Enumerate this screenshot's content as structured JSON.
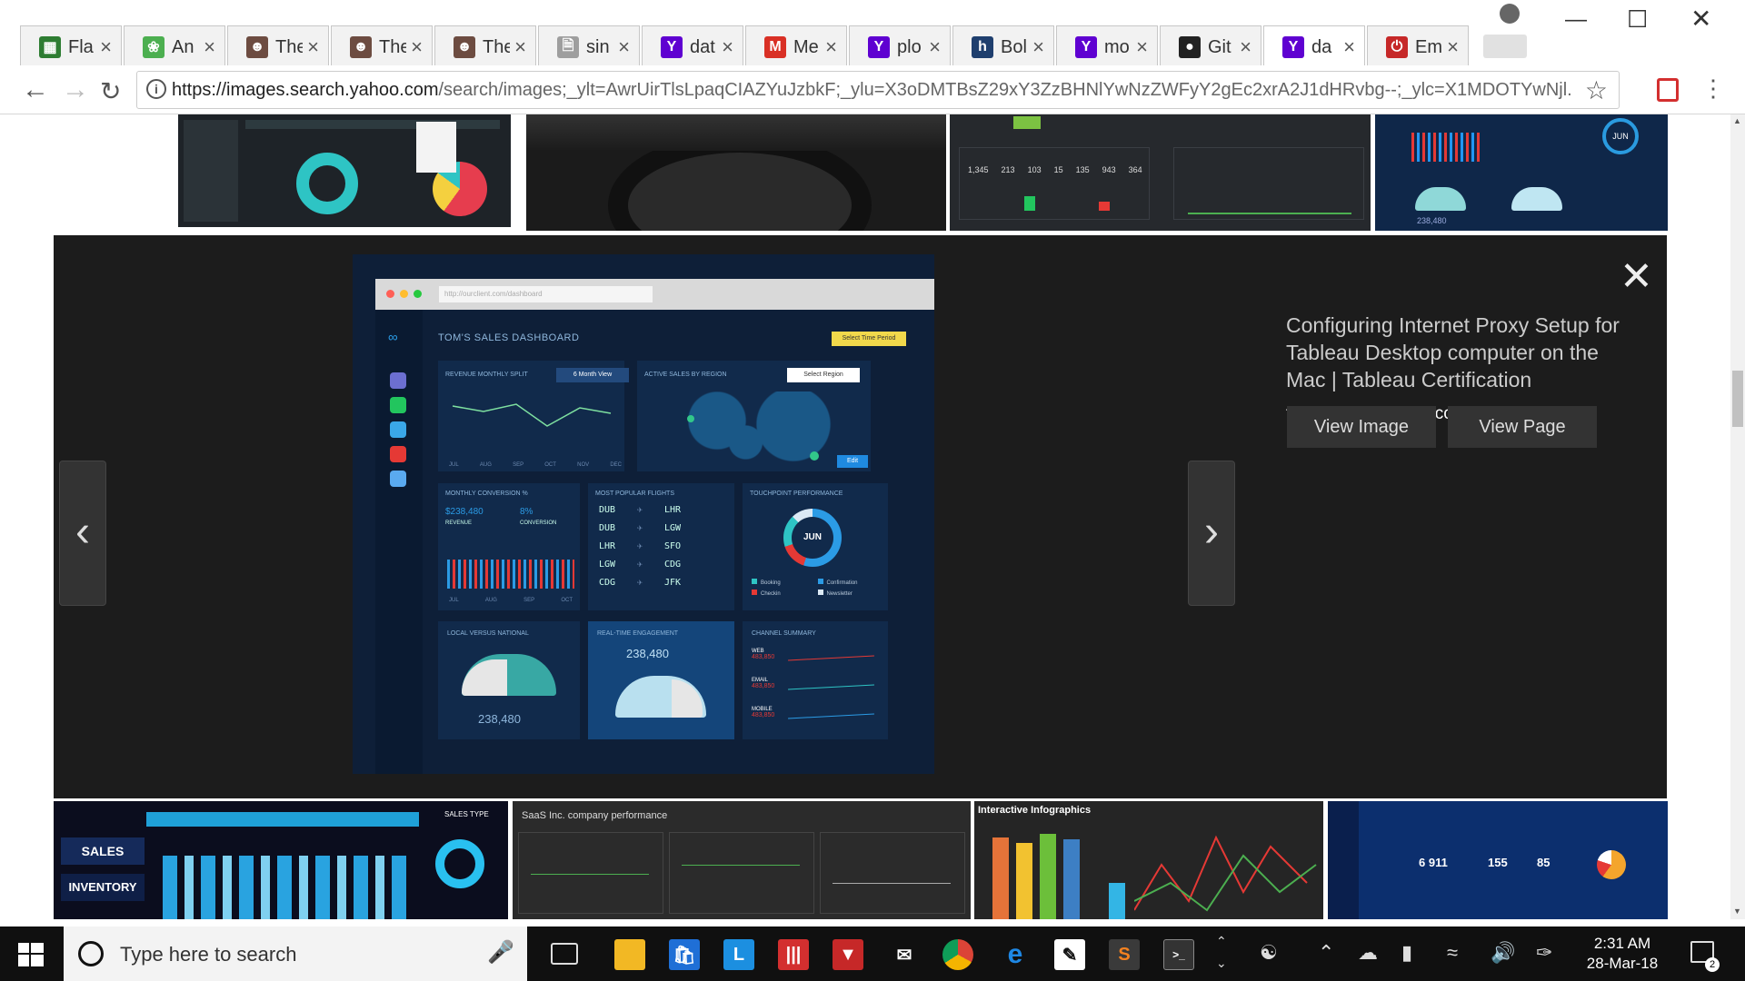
{
  "browser": {
    "tabs": [
      {
        "title": "Fla",
        "icon": "grid-icon",
        "color": "#2e7d32"
      },
      {
        "title": "An",
        "icon": "leaf-icon",
        "color": "#4caf50"
      },
      {
        "title": "The",
        "icon": "person-icon",
        "color": "#6d4c41"
      },
      {
        "title": "The",
        "icon": "person-icon",
        "color": "#6d4c41"
      },
      {
        "title": "The",
        "icon": "person-icon",
        "color": "#6d4c41"
      },
      {
        "title": "sin",
        "icon": "document-icon",
        "color": "#9e9e9e"
      },
      {
        "title": "dat",
        "icon": "yahoo-icon",
        "color": "#5f01d1"
      },
      {
        "title": "Me",
        "icon": "gmail-icon",
        "color": "#d93025"
      },
      {
        "title": "plo",
        "icon": "yahoo-icon",
        "color": "#5f01d1"
      },
      {
        "title": "Bol",
        "icon": "h-icon",
        "color": "#1f3f6e"
      },
      {
        "title": "mo",
        "icon": "yahoo-icon",
        "color": "#5f01d1"
      },
      {
        "title": "Git",
        "icon": "github-icon",
        "color": "#222222"
      },
      {
        "title": "da",
        "icon": "yahoo-icon",
        "color": "#5f01d1",
        "active": true
      },
      {
        "title": "Em",
        "icon": "power-icon",
        "color": "#c62828"
      }
    ],
    "url_domain": "https://images.search.yahoo.com",
    "url_path": "/search/images;_ylt=AwrUirTlsLpaqCIAZYuJzbkF;_ylu=X3oDMTBsZ29xY3ZzBHNlYwNzZWFyY2gEc2xrA2J1dHRvbg--;_ylc=X1MDOTYwNjl..."
  },
  "viewer": {
    "title": "Configuring Internet Proxy Setup for Tableau Desktop computer on the Mac | Tableau Certification",
    "source": "tableaucertification.com",
    "dimensions": "736x659",
    "view_image": "View Image",
    "view_page": "View Page"
  },
  "preview": {
    "url": "http://ourclient.com/dashboard",
    "title": "TOM'S SALES DASHBOARD",
    "select_period": "Select Time Period",
    "revenue_split": "REVENUE MONTHLY SPLIT",
    "month_view": "6 Month View",
    "months": [
      "JUL",
      "AUG",
      "SEP",
      "OCT",
      "NOV",
      "DEC"
    ],
    "active_sales": "ACTIVE SALES BY REGION",
    "select_region": "Select Region",
    "edit": "Edit",
    "monthly_conversion": "MONTHLY CONVERSION %",
    "revenue_value": "$238,480",
    "revenue_label": "REVENUE",
    "conversion_value": "8%",
    "conversion_label": "CONVERSION",
    "conv_months": [
      "JUL",
      "AUG",
      "SEP",
      "OCT"
    ],
    "popular_flights": "MOST POPULAR FLIGHTS",
    "flights": [
      {
        "from": "DUB",
        "to": "LHR"
      },
      {
        "from": "DUB",
        "to": "LGW"
      },
      {
        "from": "LHR",
        "to": "SFO"
      },
      {
        "from": "LGW",
        "to": "CDG"
      },
      {
        "from": "CDG",
        "to": "JFK"
      }
    ],
    "touchpoint": "TOUCHPOINT PERFORMANCE",
    "touch_center": "JUN",
    "touch_legend": [
      "Booking",
      "Confirmation",
      "Checkin",
      "Newsletter"
    ],
    "local_national": "LOCAL VERSUS NATIONAL",
    "local_value": "238,480",
    "engagement": "REAL-TIME ENGAGEMENT",
    "engagement_value": "238,480",
    "channel": "CHANNEL SUMMARY",
    "channels": [
      {
        "name": "WEB",
        "value": "483,850"
      },
      {
        "name": "EMAIL",
        "value": "483,850"
      },
      {
        "name": "MOBILE",
        "value": "483,850"
      }
    ]
  },
  "thumbnails_bottom": {
    "t1_a": "SALES",
    "t1_b": "INVENTORY",
    "t1_c": "SALES TYPE",
    "t2": "SaaS Inc. company performance",
    "t3": "Interactive Infographics",
    "t4_a": "6 911",
    "t4_b": "155",
    "t4_c": "85"
  },
  "thumbnails_top": {
    "t3_nums": [
      "1,345",
      "213",
      "103",
      "15",
      "135",
      "943",
      "364"
    ],
    "t4_num": "238,480",
    "t4_badge": "JUN"
  },
  "taskbar": {
    "search_placeholder": "Type here to search",
    "time": "2:31 AM",
    "date": "28-Mar-18",
    "notifications": "2"
  }
}
